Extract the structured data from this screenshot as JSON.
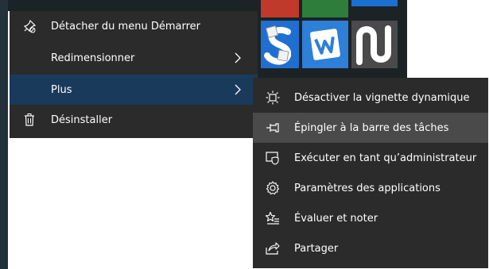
{
  "main_menu": {
    "items": [
      {
        "label": "Détacher du menu Démarrer",
        "icon": "unpin-icon"
      },
      {
        "label": "Redimensionner",
        "icon": "",
        "has_submenu": true
      },
      {
        "label": "Plus",
        "icon": "",
        "has_submenu": true,
        "active": true
      },
      {
        "label": "Désinstaller",
        "icon": "trash-icon"
      }
    ]
  },
  "sub_menu": {
    "items": [
      {
        "label": "Désactiver la vignette dynamique",
        "icon": "live-tile-icon"
      },
      {
        "label": "Épingler à la barre des tâches",
        "icon": "pin-taskbar-icon",
        "hover": true
      },
      {
        "label": "Exécuter en tant qu’administrateur",
        "icon": "shield-icon"
      },
      {
        "label": "Paramètres des applications",
        "icon": "gear-icon"
      },
      {
        "label": "Évaluer et noter",
        "icon": "star-rate-icon"
      },
      {
        "label": "Partager",
        "icon": "share-icon"
      }
    ]
  },
  "tiles": [
    {
      "name": "scrabble-tile",
      "color": "#1f6fd1"
    },
    {
      "name": "word-tile",
      "color": "#2e7fd8"
    },
    {
      "name": "note-tile",
      "color": "#4a4a4a"
    }
  ],
  "colors": {
    "menu_bg": "#2b2b2b",
    "active_bg": "#1a3a5c",
    "hover_bg": "#4a4a4a",
    "text": "#ffffff"
  }
}
